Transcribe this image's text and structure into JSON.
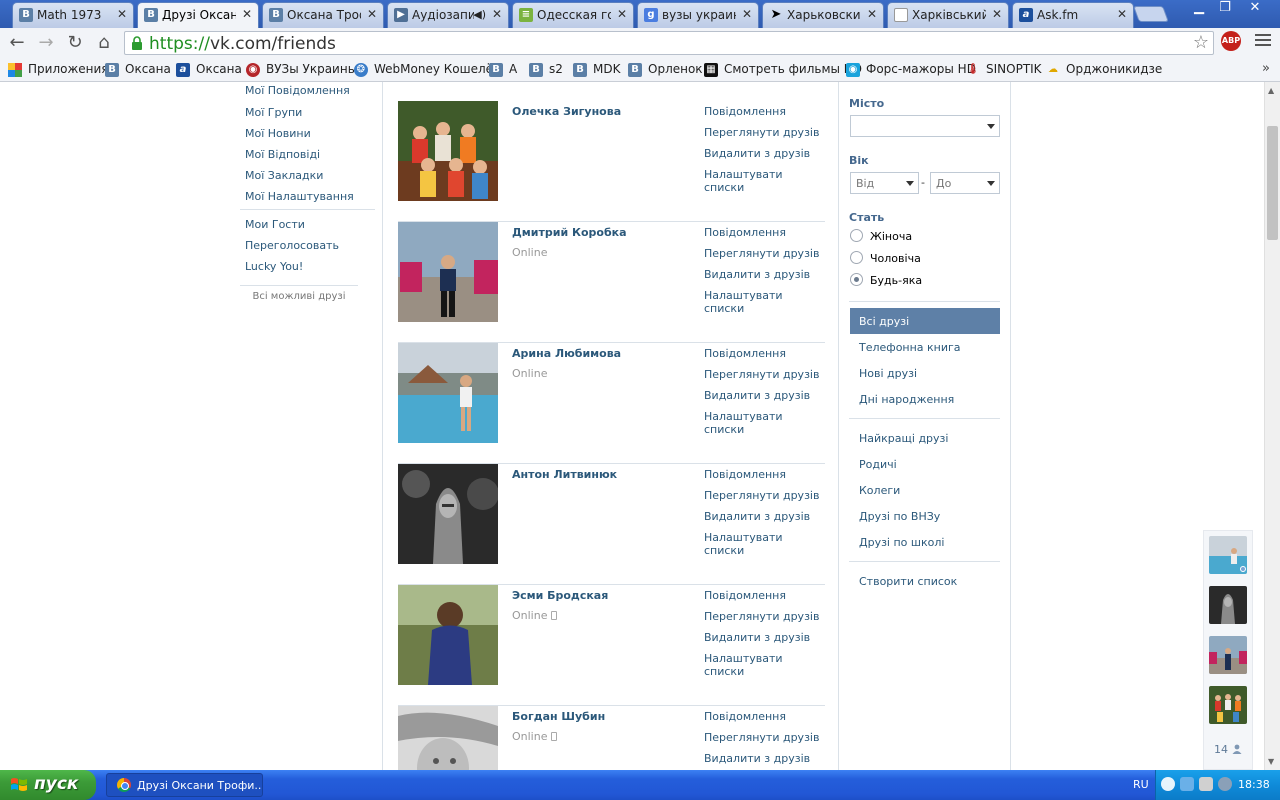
{
  "browser": {
    "tabs": [
      {
        "label": "Math 1973",
        "icon": "vk-icon"
      },
      {
        "label": "Друзі Оксани",
        "icon": "vk-icon",
        "active": true
      },
      {
        "label": "Оксана Трофи",
        "icon": "vk-icon"
      },
      {
        "label": "Аудіозапис",
        "icon": "audio-icon"
      },
      {
        "label": "Одесская гос",
        "icon": "doc-icon"
      },
      {
        "label": "вузы украинь",
        "icon": "google-icon"
      },
      {
        "label": "Харьковский",
        "icon": "cursor-icon"
      },
      {
        "label": "Харківський н",
        "icon": "page-icon"
      },
      {
        "label": "Ask.fm",
        "icon": "askfm-icon"
      }
    ],
    "url_scheme": "https://",
    "url_rest": "vk.com/friends",
    "abp_label": "ABP"
  },
  "bookmarks": [
    {
      "label": "Приложения",
      "icon": "apps-icon"
    },
    {
      "label": "Оксана",
      "icon": "vk-icon"
    },
    {
      "label": "Оксана",
      "icon": "askfm-icon"
    },
    {
      "label": "ВУЗы Украины",
      "icon": "vuz-icon"
    },
    {
      "label": "WebMoney Кошелёк",
      "icon": "webmoney-icon"
    },
    {
      "label": "А",
      "icon": "vk-icon"
    },
    {
      "label": "s2",
      "icon": "vk-icon"
    },
    {
      "label": "MDK",
      "icon": "vk-icon"
    },
    {
      "label": "Орленок",
      "icon": "vk-icon"
    },
    {
      "label": "Смотреть фильмы HD",
      "icon": "film-icon"
    },
    {
      "label": "Форс-мажоры HD",
      "icon": "eye-icon"
    },
    {
      "label": "SINOPTIK",
      "icon": "thermometer-icon"
    },
    {
      "label": "Орджоникидзе",
      "icon": "weather-icon"
    }
  ],
  "left_menu": {
    "items": [
      "Мої Повідомлення",
      "Мої Групи",
      "Мої Новини",
      "Мої Відповіді",
      "Мої Закладки",
      "Мої Налаштування"
    ],
    "extra": [
      "Мои Гости",
      "Переголосовать",
      "Lucky You!"
    ],
    "possible_friends": "Всі можливі друзі"
  },
  "friends": [
    {
      "name": "Олечка Зигунова",
      "status": "",
      "mobile": false
    },
    {
      "name": "Дмитрий Коробка",
      "status": "Online",
      "mobile": false
    },
    {
      "name": "Арина Любимова",
      "status": "Online",
      "mobile": false
    },
    {
      "name": "Антон Литвинюк",
      "status": "",
      "mobile": false
    },
    {
      "name": "Эсми Бродская",
      "status": "Online",
      "mobile": true
    },
    {
      "name": "Богдан Шубин",
      "status": "Online",
      "mobile": true
    }
  ],
  "friend_actions": [
    "Повідомлення",
    "Переглянути друзів",
    "Видалити з друзів",
    "Налаштувати списки"
  ],
  "filters": {
    "city_label": "Місто",
    "city_value": "",
    "age_label": "Вік",
    "age_from": "Від",
    "age_to": "До",
    "age_dash": "-",
    "sex_label": "Стать",
    "sex_options": [
      "Жіноча",
      "Чоловіча",
      "Будь-яка"
    ],
    "sex_selected": 2,
    "lists_main": [
      "Всі друзі",
      "Телефонна книга",
      "Нові друзі",
      "Дні народження"
    ],
    "lists_groups": [
      "Найкращі друзі",
      "Родичі",
      "Колеги",
      "Друзі по ВНЗу",
      "Друзі по школі"
    ],
    "create_list": "Створити список"
  },
  "online_sidebar": {
    "count": "14"
  },
  "taskbar": {
    "start_label": "пуск",
    "window_label": "Друзі Оксани Трофи...",
    "lang": "RU",
    "time": "18:38"
  }
}
